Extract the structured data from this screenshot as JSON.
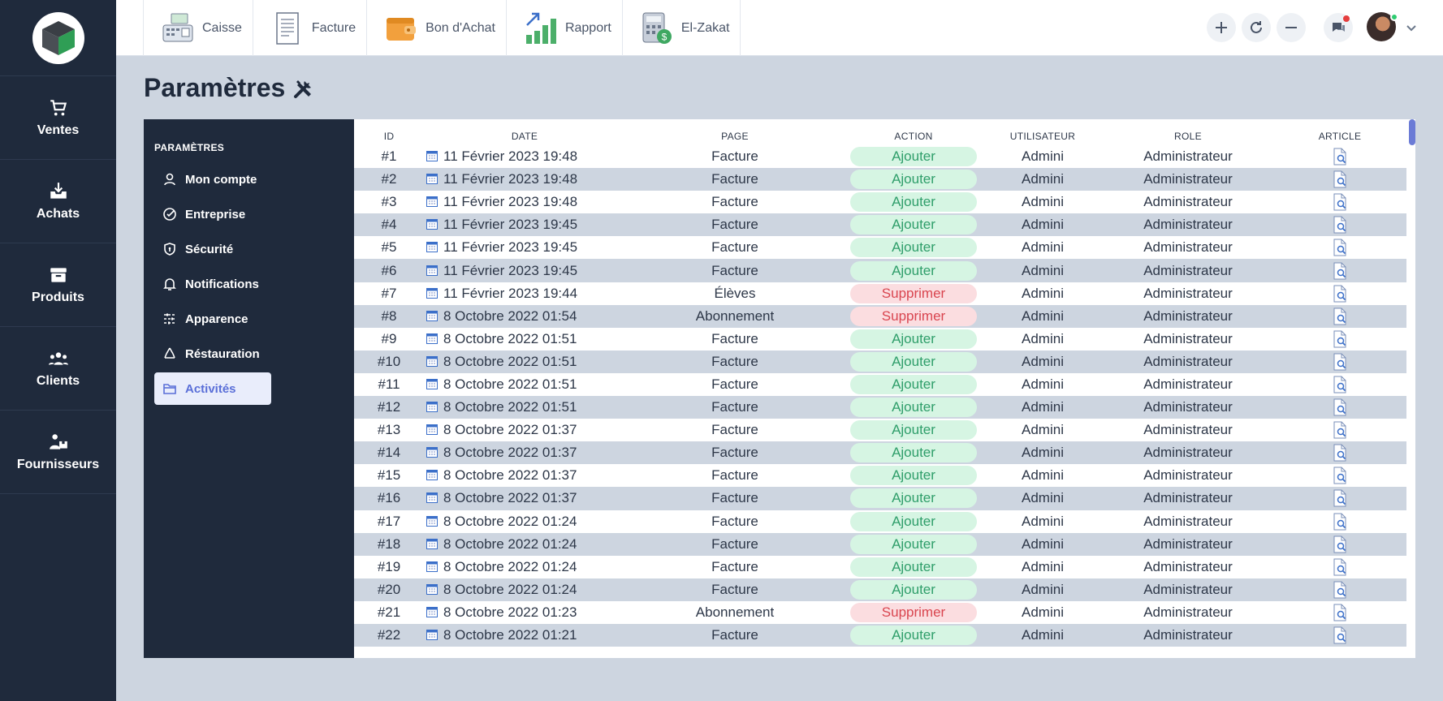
{
  "sidebar": {
    "items": [
      {
        "label": "Ventes",
        "icon": "cart-icon"
      },
      {
        "label": "Achats",
        "icon": "inbox-download-icon"
      },
      {
        "label": "Produits",
        "icon": "box-icon"
      },
      {
        "label": "Clients",
        "icon": "users-icon"
      },
      {
        "label": "Fournisseurs",
        "icon": "supplier-icon"
      }
    ]
  },
  "toolbar": {
    "items": [
      {
        "label": "Caisse",
        "icon": "cash-register-icon"
      },
      {
        "label": "Facture",
        "icon": "invoice-icon"
      },
      {
        "label": "Bon d'Achat",
        "icon": "wallet-icon"
      },
      {
        "label": "Rapport",
        "icon": "bar-chart-icon"
      },
      {
        "label": "El-Zakat",
        "icon": "calculator-icon"
      }
    ]
  },
  "page": {
    "title": "Paramètres",
    "title_icon": "tools-icon"
  },
  "settings": {
    "heading": "PARAMÈTRES",
    "items": [
      {
        "label": "Mon compte",
        "icon": "user-icon"
      },
      {
        "label": "Entreprise",
        "icon": "check-circle-icon"
      },
      {
        "label": "Sécurité",
        "icon": "shield-icon"
      },
      {
        "label": "Notifications",
        "icon": "bell-icon"
      },
      {
        "label": "Apparence",
        "icon": "sliders-icon"
      },
      {
        "label": "Réstauration",
        "icon": "recycle-icon"
      },
      {
        "label": "Activités",
        "icon": "folder-icon",
        "active": true
      }
    ]
  },
  "table": {
    "columns": [
      "ID",
      "DATE",
      "PAGE",
      "ACTION",
      "UTILISATEUR",
      "ROLE",
      "ARTICLE"
    ],
    "rows": [
      {
        "id": "#1",
        "date": "11 Février 2023 19:48",
        "page": "Facture",
        "action": "Ajouter",
        "user": "Admini",
        "role": "Administrateur"
      },
      {
        "id": "#2",
        "date": "11 Février 2023 19:48",
        "page": "Facture",
        "action": "Ajouter",
        "user": "Admini",
        "role": "Administrateur"
      },
      {
        "id": "#3",
        "date": "11 Février 2023 19:48",
        "page": "Facture",
        "action": "Ajouter",
        "user": "Admini",
        "role": "Administrateur"
      },
      {
        "id": "#4",
        "date": "11 Février 2023 19:45",
        "page": "Facture",
        "action": "Ajouter",
        "user": "Admini",
        "role": "Administrateur"
      },
      {
        "id": "#5",
        "date": "11 Février 2023 19:45",
        "page": "Facture",
        "action": "Ajouter",
        "user": "Admini",
        "role": "Administrateur"
      },
      {
        "id": "#6",
        "date": "11 Février 2023 19:45",
        "page": "Facture",
        "action": "Ajouter",
        "user": "Admini",
        "role": "Administrateur"
      },
      {
        "id": "#7",
        "date": "11 Février 2023 19:44",
        "page": "Élèves",
        "action": "Supprimer",
        "user": "Admini",
        "role": "Administrateur"
      },
      {
        "id": "#8",
        "date": "8 Octobre 2022 01:54",
        "page": "Abonnement",
        "action": "Supprimer",
        "user": "Admini",
        "role": "Administrateur"
      },
      {
        "id": "#9",
        "date": "8 Octobre 2022 01:51",
        "page": "Facture",
        "action": "Ajouter",
        "user": "Admini",
        "role": "Administrateur"
      },
      {
        "id": "#10",
        "date": "8 Octobre 2022 01:51",
        "page": "Facture",
        "action": "Ajouter",
        "user": "Admini",
        "role": "Administrateur"
      },
      {
        "id": "#11",
        "date": "8 Octobre 2022 01:51",
        "page": "Facture",
        "action": "Ajouter",
        "user": "Admini",
        "role": "Administrateur"
      },
      {
        "id": "#12",
        "date": "8 Octobre 2022 01:51",
        "page": "Facture",
        "action": "Ajouter",
        "user": "Admini",
        "role": "Administrateur"
      },
      {
        "id": "#13",
        "date": "8 Octobre 2022 01:37",
        "page": "Facture",
        "action": "Ajouter",
        "user": "Admini",
        "role": "Administrateur"
      },
      {
        "id": "#14",
        "date": "8 Octobre 2022 01:37",
        "page": "Facture",
        "action": "Ajouter",
        "user": "Admini",
        "role": "Administrateur"
      },
      {
        "id": "#15",
        "date": "8 Octobre 2022 01:37",
        "page": "Facture",
        "action": "Ajouter",
        "user": "Admini",
        "role": "Administrateur"
      },
      {
        "id": "#16",
        "date": "8 Octobre 2022 01:37",
        "page": "Facture",
        "action": "Ajouter",
        "user": "Admini",
        "role": "Administrateur"
      },
      {
        "id": "#17",
        "date": "8 Octobre 2022 01:24",
        "page": "Facture",
        "action": "Ajouter",
        "user": "Admini",
        "role": "Administrateur"
      },
      {
        "id": "#18",
        "date": "8 Octobre 2022 01:24",
        "page": "Facture",
        "action": "Ajouter",
        "user": "Admini",
        "role": "Administrateur"
      },
      {
        "id": "#19",
        "date": "8 Octobre 2022 01:24",
        "page": "Facture",
        "action": "Ajouter",
        "user": "Admini",
        "role": "Administrateur"
      },
      {
        "id": "#20",
        "date": "8 Octobre 2022 01:24",
        "page": "Facture",
        "action": "Ajouter",
        "user": "Admini",
        "role": "Administrateur"
      },
      {
        "id": "#21",
        "date": "8 Octobre 2022 01:23",
        "page": "Abonnement",
        "action": "Supprimer",
        "user": "Admini",
        "role": "Administrateur"
      },
      {
        "id": "#22",
        "date": "8 Octobre 2022 01:21",
        "page": "Facture",
        "action": "Ajouter",
        "user": "Admini",
        "role": "Administrateur"
      }
    ]
  },
  "colors": {
    "sidebar": "#1f2a3c",
    "background": "#cdd5e0",
    "add": "#2f9e6a",
    "delete": "#d9454f",
    "accent": "#5a6fd8"
  }
}
